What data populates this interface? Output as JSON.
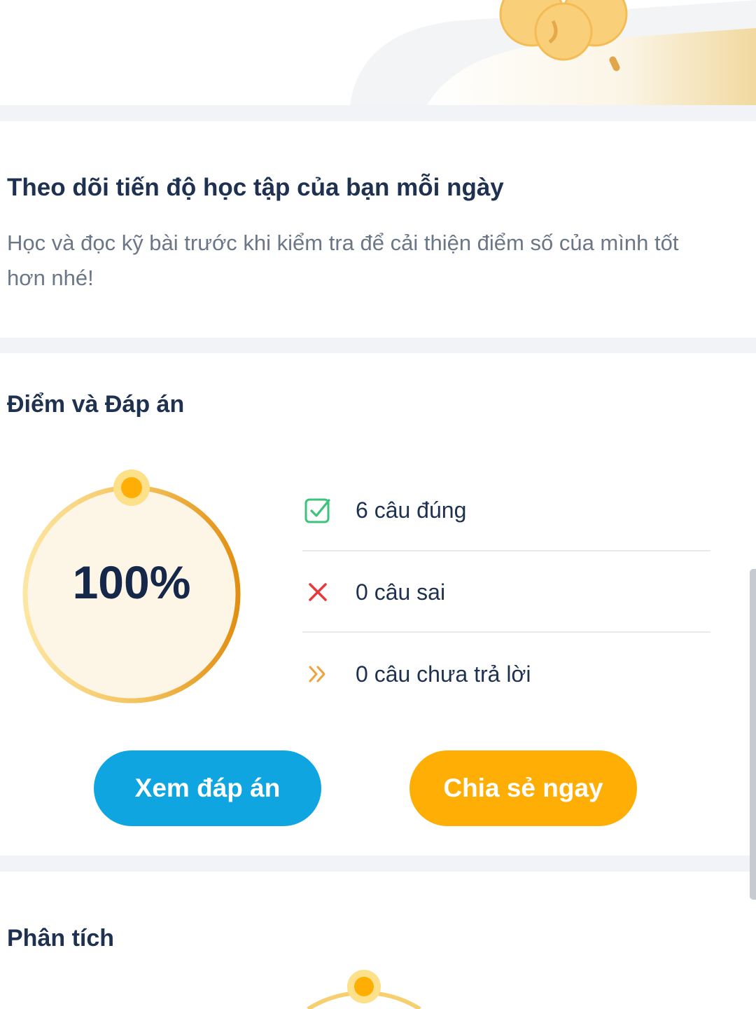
{
  "progress_section": {
    "title": "Theo dõi tiến độ học tập của bạn mỗi ngày",
    "description": "Học và đọc kỹ bài trước khi kiểm tra để cải thiện điểm số của mình tốt hơn nhé!"
  },
  "score_section": {
    "title": "Điểm và Đáp án",
    "score": {
      "text": "100%",
      "fraction": 1.0
    },
    "stats": [
      {
        "icon": "check-square-icon",
        "label": "6 câu đúng"
      },
      {
        "icon": "x-icon",
        "label": "0 câu sai"
      },
      {
        "icon": "double-chevron-right-icon",
        "label": "0 câu chưa trả lời"
      }
    ],
    "view_answers_button": "Xem đáp án",
    "share_button": "Chia sẻ ngay"
  },
  "analysis_section": {
    "title": "Phân tích"
  },
  "colors": {
    "primary_blue": "#0ea5e0",
    "accent_orange": "#ffae06",
    "correct_green": "#3cc37a",
    "wrong_red": "#e8383b",
    "skip_orange": "#f0a23a",
    "heading": "#1e3150",
    "muted_text": "#6b7787"
  }
}
